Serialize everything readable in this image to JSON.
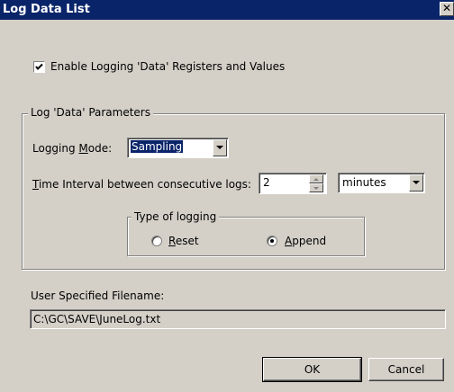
{
  "window": {
    "title": "Log Data List",
    "close_glyph": "✕"
  },
  "enable_logging": {
    "label": "Enable Logging 'Data' Registers and Values",
    "checked": true
  },
  "parameters_group": {
    "legend": "Log 'Data' Parameters"
  },
  "logging_mode": {
    "label_prefix": "Logging ",
    "label_accel": "M",
    "label_suffix": "ode:",
    "value": "Sampling"
  },
  "time_interval": {
    "label_accel": "T",
    "label_rest": "ime Interval between consecutive logs:",
    "value": "2",
    "unit": "minutes"
  },
  "type_of_logging": {
    "legend": "Type of logging",
    "reset": {
      "accel": "R",
      "rest": "eset",
      "selected": false
    },
    "append": {
      "accel": "A",
      "rest": "ppend",
      "selected": true
    }
  },
  "filename": {
    "label": "User Specified Filename:",
    "value": "C:\\GC\\SAVE\\JuneLog.txt"
  },
  "buttons": {
    "ok": "OK",
    "cancel": "Cancel"
  }
}
